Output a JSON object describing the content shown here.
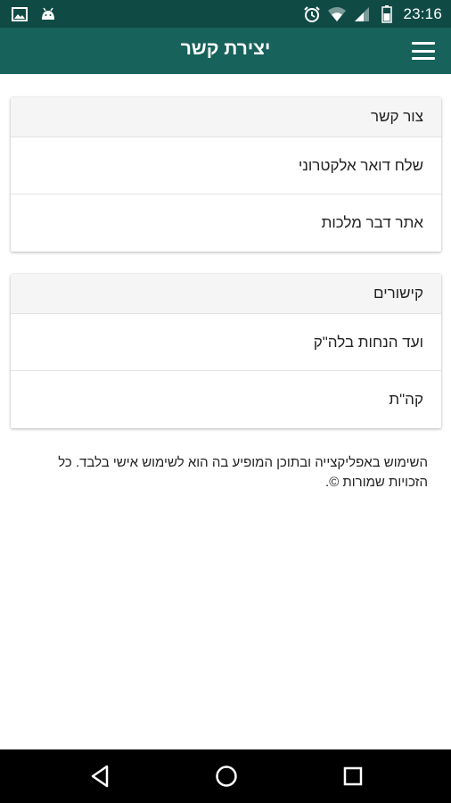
{
  "status_bar": {
    "time": "23:16",
    "icons": [
      "image-icon",
      "android-icon",
      "alarm-icon",
      "wifi-icon",
      "signal-icon",
      "battery-icon"
    ]
  },
  "app_bar": {
    "title": "יצירת קשר",
    "menu_icon": "hamburger-menu-icon"
  },
  "contact_card": {
    "header": "צור קשר",
    "items": [
      {
        "label": "שלח דואר אלקטרוני"
      },
      {
        "label": "אתר דבר מלכות"
      }
    ]
  },
  "links_card": {
    "header": "קישורים",
    "items": [
      {
        "label": "ועד הנחות בלה\"ק"
      },
      {
        "label": "קה\"ת"
      }
    ]
  },
  "footer": {
    "text": "השימוש באפליקצייה ובתוכן המופיע בה הוא לשימוש אישי בלבד. כל הזכויות שמורות ©."
  },
  "nav_bar": {
    "icons": [
      "back-icon",
      "home-icon",
      "recent-apps-icon"
    ]
  },
  "colors": {
    "status_bar": "#0f4a45",
    "app_bar": "#17625b",
    "card_header": "#f5f5f5"
  }
}
